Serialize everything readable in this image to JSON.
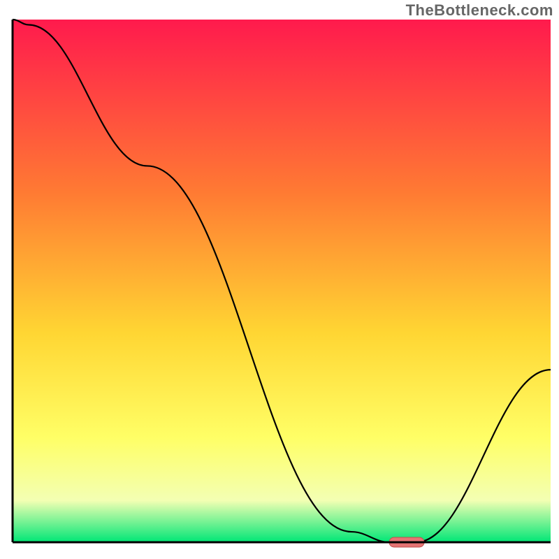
{
  "watermark": "TheBottleneck.com",
  "colors": {
    "gradient_top": "#ff1a4d",
    "gradient_mid_upper": "#ff7a33",
    "gradient_mid": "#ffd633",
    "gradient_mid_lower": "#ffff66",
    "gradient_light": "#f3ffb3",
    "gradient_green": "#00e676",
    "axis": "#000000",
    "curve": "#000000",
    "marker_fill": "#e57373",
    "marker_stroke": "#c0504d"
  },
  "chart_data": {
    "type": "line",
    "title": "",
    "xlabel": "",
    "ylabel": "",
    "xlim": [
      0,
      100
    ],
    "ylim": [
      0,
      100
    ],
    "x": [
      0,
      3,
      25,
      63,
      70,
      75,
      100
    ],
    "y": [
      100,
      99,
      72,
      2,
      0,
      0,
      33
    ],
    "marker": {
      "x_start": 70,
      "x_end": 76.5,
      "y": 0
    },
    "legend": false,
    "grid": false
  }
}
